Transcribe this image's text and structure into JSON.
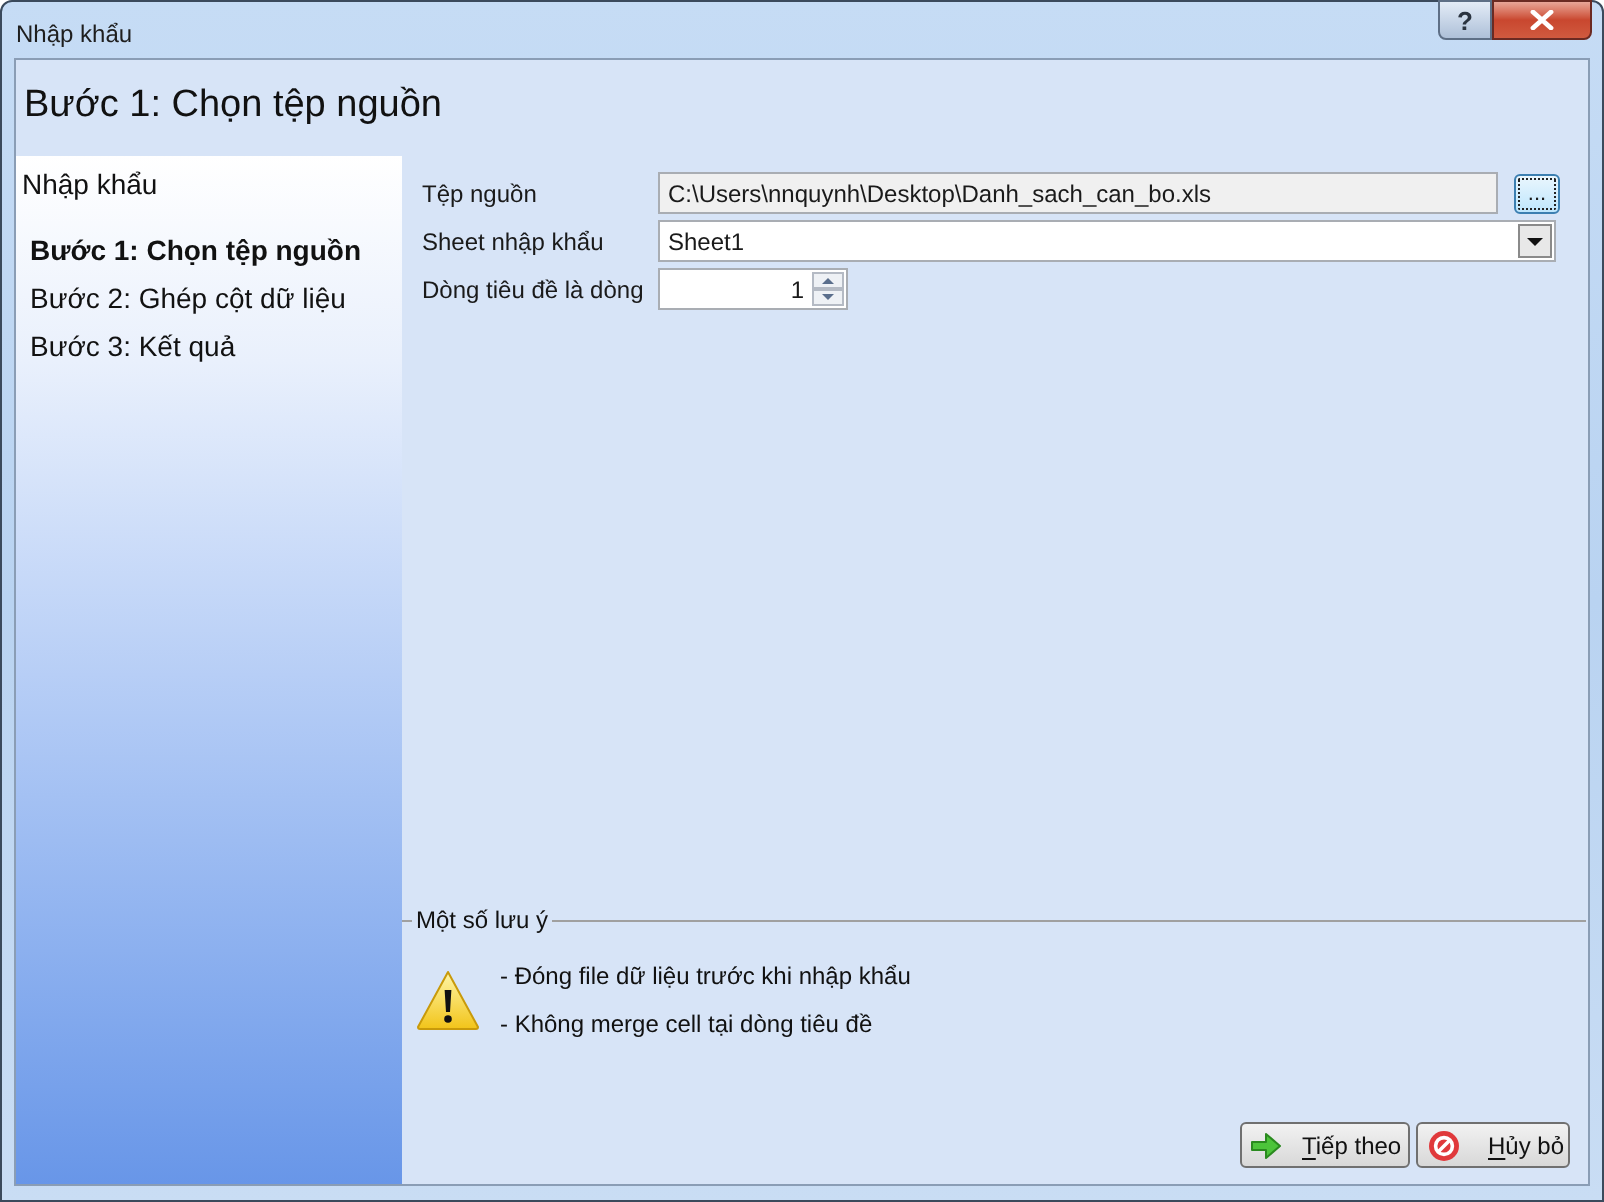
{
  "window": {
    "title": "Nhập khẩu",
    "help_button": "?"
  },
  "header": {
    "title": "Bước 1: Chọn tệp nguồn"
  },
  "sidebar": {
    "title": "Nhập khẩu",
    "steps": [
      {
        "label": "Bước 1: Chọn tệp nguồn",
        "selected": true
      },
      {
        "label": "Bước 2: Ghép cột dữ liệu",
        "selected": false
      },
      {
        "label": "Bước 3: Kết quả",
        "selected": false
      }
    ]
  },
  "form": {
    "fields": [
      {
        "kind": "file",
        "label": "Tệp nguồn",
        "value": "C:\\Users\\nnquynh\\Desktop\\Danh_sach_can_bo.xls",
        "button": {
          "label": "...",
          "focused": true
        }
      },
      {
        "kind": "select",
        "label": "Sheet nhập khẩu",
        "value": "Sheet1"
      },
      {
        "kind": "spinner",
        "label": "Dòng tiêu đề là dòng",
        "value": "1"
      }
    ]
  },
  "notes": {
    "title": "Một số lưu ý",
    "items": [
      "- Đóng file dữ liệu trước khi nhập khẩu",
      "- Không merge cell tại dòng tiêu đề"
    ]
  },
  "buttons": [
    {
      "kind": "next",
      "label": "Tiếp theo",
      "mnemonic_underlined": true
    },
    {
      "kind": "cancel",
      "label": "Hủy bỏ",
      "mnemonic_underlined": true
    }
  ]
}
